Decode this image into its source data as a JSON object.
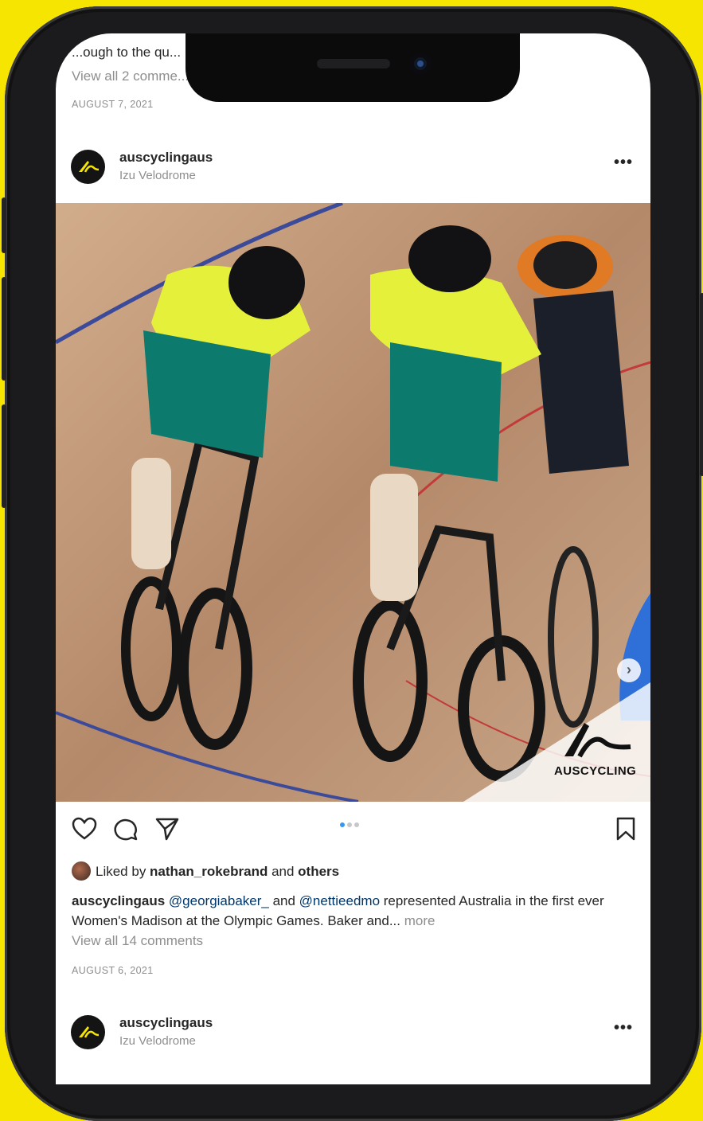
{
  "previous_post": {
    "caption_partial": "...ough to the qu...",
    "view_comments": "View all 2 comme...",
    "date": "AUGUST 7, 2021"
  },
  "post": {
    "username": "auscyclingaus",
    "location": "Izu Velodrome",
    "more_label": "•••",
    "image_logo_text": "AUSCYCLING",
    "carousel": {
      "count": 3,
      "active_index": 0
    },
    "liked_by_prefix": "Liked by ",
    "liked_by_user": "nathan_rokebrand",
    "liked_by_joiner": " and ",
    "liked_by_others": "others",
    "caption_user": "auscyclingaus",
    "caption_mention1": "@georgiabaker_",
    "caption_and": " and ",
    "caption_mention2": "@nettieedmo",
    "caption_text": " represented Australia in the first ever Women's Madison at the Olympic Games. Baker and...",
    "caption_more": "more",
    "view_comments": "View all 14 comments",
    "date": "AUGUST 6, 2021"
  },
  "next_post": {
    "username": "auscyclingaus",
    "location": "Izu Velodrome",
    "more_label": "•••"
  },
  "icons": {
    "like": "heart-icon",
    "comment": "comment-icon",
    "share": "paper-plane-icon",
    "save": "bookmark-icon",
    "next": "chevron-right-icon"
  },
  "colors": {
    "background": "#f6e500",
    "mention": "#00376b",
    "muted": "#8e8e8e",
    "carousel_active": "#3897f0"
  }
}
